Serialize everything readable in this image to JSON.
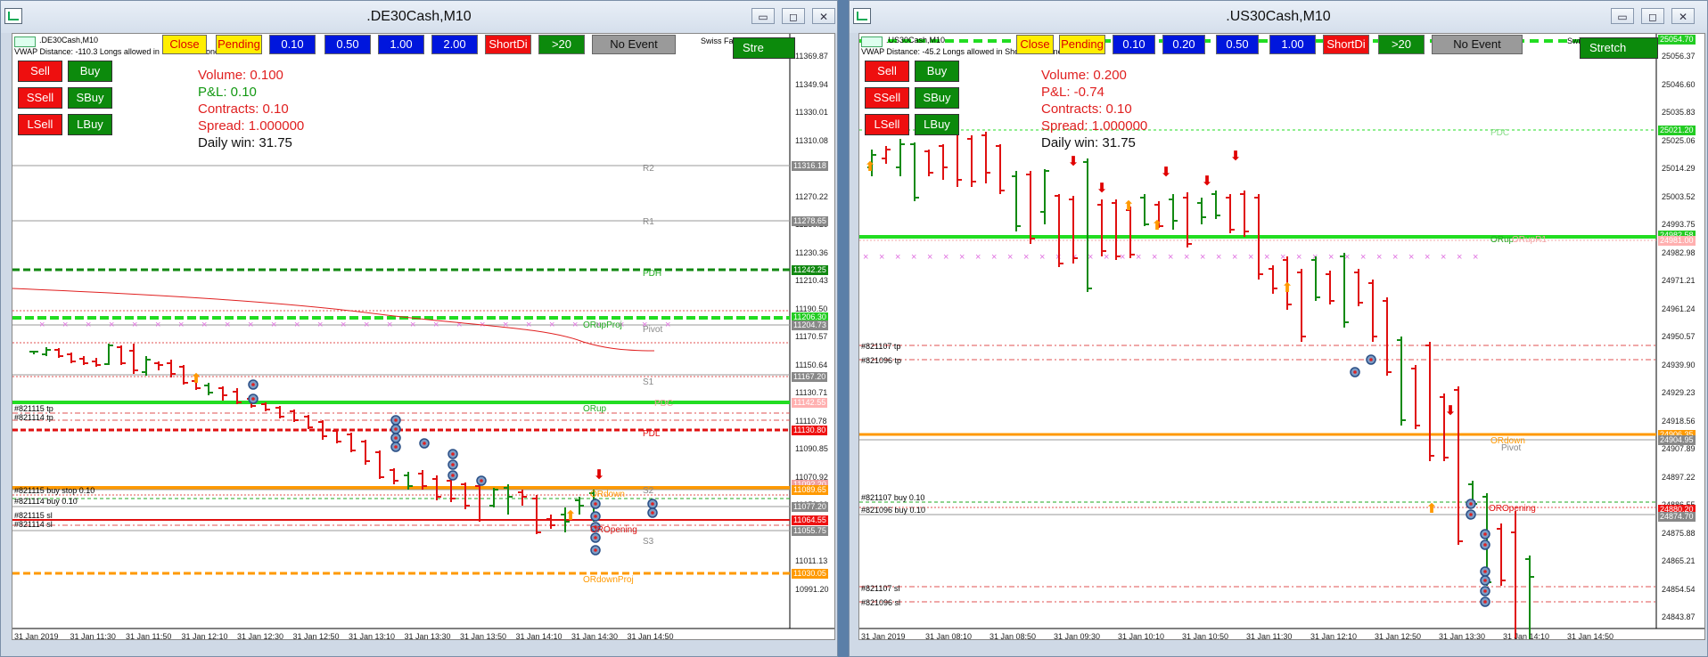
{
  "windows": [
    {
      "title": ".DE30Cash,M10",
      "symbol_line": ".DE30Cash,M10",
      "vwap_line": "VWAP Distance: -110.3 Longs allowed in Short Bias Zone",
      "corner_label": "Swiss FactoClock",
      "stretch_label": "Stre",
      "buttons": [
        "Close",
        "Pending",
        "0.10",
        "0.50",
        "1.00",
        "2.00",
        "ShortDi",
        ">20",
        "No Event"
      ],
      "trade_buttons": [
        [
          "Sell",
          "Buy"
        ],
        [
          "SSell",
          "SBuy"
        ],
        [
          "LSell",
          "LBuy"
        ]
      ],
      "info": {
        "volume": "Volume: 0.100",
        "pl": "P&L: 0.10",
        "contracts": "Contracts: 0.10",
        "spread": "Spread: 1.000000",
        "daily": "Daily win: 31.75"
      },
      "y_ticks": [
        "11369.87",
        "11349.94",
        "11330.01",
        "11310.08",
        "11290.15",
        "11270.22",
        "11250.29",
        "11230.36",
        "11210.43",
        "11190.50",
        "11170.57",
        "11150.64",
        "11130.71",
        "11110.78",
        "11090.85",
        "11070.92",
        "11050.99",
        "11031.06",
        "11011.13",
        "10991.20"
      ],
      "x_ticks": [
        "31 Jan 2019",
        "31 Jan 11:30",
        "31 Jan 11:50",
        "31 Jan 12:10",
        "31 Jan 12:30",
        "31 Jan 12:50",
        "31 Jan 13:10",
        "31 Jan 13:30",
        "31 Jan 13:50",
        "31 Jan 14:10",
        "31 Jan 14:30",
        "31 Jan 14:50"
      ],
      "price_tags": [
        {
          "text": "11316.18",
          "color": "#888888"
        },
        {
          "text": "11278.65",
          "color": "#888888"
        },
        {
          "text": "11242.25",
          "color": "#118811"
        },
        {
          "text": "11206.30",
          "color": "#22cc22"
        },
        {
          "text": "11204.73",
          "color": "#888888"
        },
        {
          "text": "11167.20",
          "color": "#888888"
        },
        {
          "text": "11142.55",
          "color": "#ffb0b0"
        },
        {
          "text": "11130.80",
          "color": "#ee1111"
        },
        {
          "text": "11092.20",
          "color": "#f0a0a0"
        },
        {
          "text": "11089.65",
          "color": "#ff9900"
        },
        {
          "text": "11077.20",
          "color": "#888888"
        },
        {
          "text": "11064.55",
          "color": "#ee1111"
        },
        {
          "text": "11055.75",
          "color": "#888888"
        },
        {
          "text": "11030.05",
          "color": "#ff9900"
        }
      ],
      "levels": [
        "R2",
        "R1",
        "PDH",
        "ORupProj",
        "Pivot",
        "S1",
        "ORup",
        "PDL",
        "S2",
        "ORdown",
        "S3",
        "ORdownProj",
        "PDC",
        "OROpening"
      ],
      "orders": [
        "#821115 tp",
        "#821114 tp",
        "#821115 buy stop 0.10",
        "#821114 buy 0.10",
        "#821115 sl",
        "#821114 sl"
      ]
    },
    {
      "title": ".US30Cash,M10",
      "symbol_line": ".US30Cash,M10",
      "vwap_line": "VWAP Distance: -45.2 Longs allowed in Short Bias Zone",
      "corner_label": "Swiss FactoClock",
      "stretch_label": "Stretch",
      "buttons": [
        "Close",
        "Pending",
        "0.10",
        "0.20",
        "0.50",
        "1.00",
        "ShortDi",
        ">20",
        "No Event"
      ],
      "trade_buttons": [
        [
          "Sell",
          "Buy"
        ],
        [
          "SSell",
          "SBuy"
        ],
        [
          "LSell",
          "LBuy"
        ]
      ],
      "info": {
        "volume": "Volume: 0.200",
        "pl": "P&L: -0.74",
        "contracts": "Contracts: 0.10",
        "spread": "Spread: 1.000000",
        "daily": "Daily win: 31.75"
      },
      "y_ticks": [
        "25056.37",
        "25046.60",
        "25035.83",
        "25025.06",
        "25014.29",
        "25003.52",
        "24993.75",
        "24982.98",
        "24971.21",
        "24961.24",
        "24950.57",
        "24939.90",
        "24929.23",
        "24918.56",
        "24907.89",
        "24897.22",
        "24886.55",
        "24875.88",
        "24865.21",
        "24854.54",
        "24843.87"
      ],
      "x_ticks": [
        "31 Jan 2019",
        "31 Jan 08:10",
        "31 Jan 08:50",
        "31 Jan 09:30",
        "31 Jan 10:10",
        "31 Jan 10:50",
        "31 Jan 11:30",
        "31 Jan 12:10",
        "31 Jan 12:50",
        "31 Jan 13:30",
        "31 Jan 14:10",
        "31 Jan 14:50"
      ],
      "price_tags": [
        {
          "text": "25054.70",
          "color": "#22cc22"
        },
        {
          "text": "25021.20",
          "color": "#22cc22"
        },
        {
          "text": "24982.58",
          "color": "#22cc22"
        },
        {
          "text": "24981.00",
          "color": "#ffb0b0"
        },
        {
          "text": "24906.35",
          "color": "#ff9900"
        },
        {
          "text": "24904.95",
          "color": "#888888"
        },
        {
          "text": "24880.20",
          "color": "#ee1111"
        },
        {
          "text": "24874.70",
          "color": "#888888"
        }
      ],
      "levels": [
        "PDC",
        "ORup",
        "ORupR1",
        "ORdown",
        "Pivot",
        "OROpening"
      ],
      "orders": [
        "#821107 tp",
        "#821096 tp",
        "#821107 buy 0.10",
        "#821096 buy 0.10",
        "#821107 sl",
        "#821096 sl"
      ]
    }
  ],
  "window_controls": {
    "minimize": "▭",
    "maximize": "◻",
    "close": "✕"
  }
}
